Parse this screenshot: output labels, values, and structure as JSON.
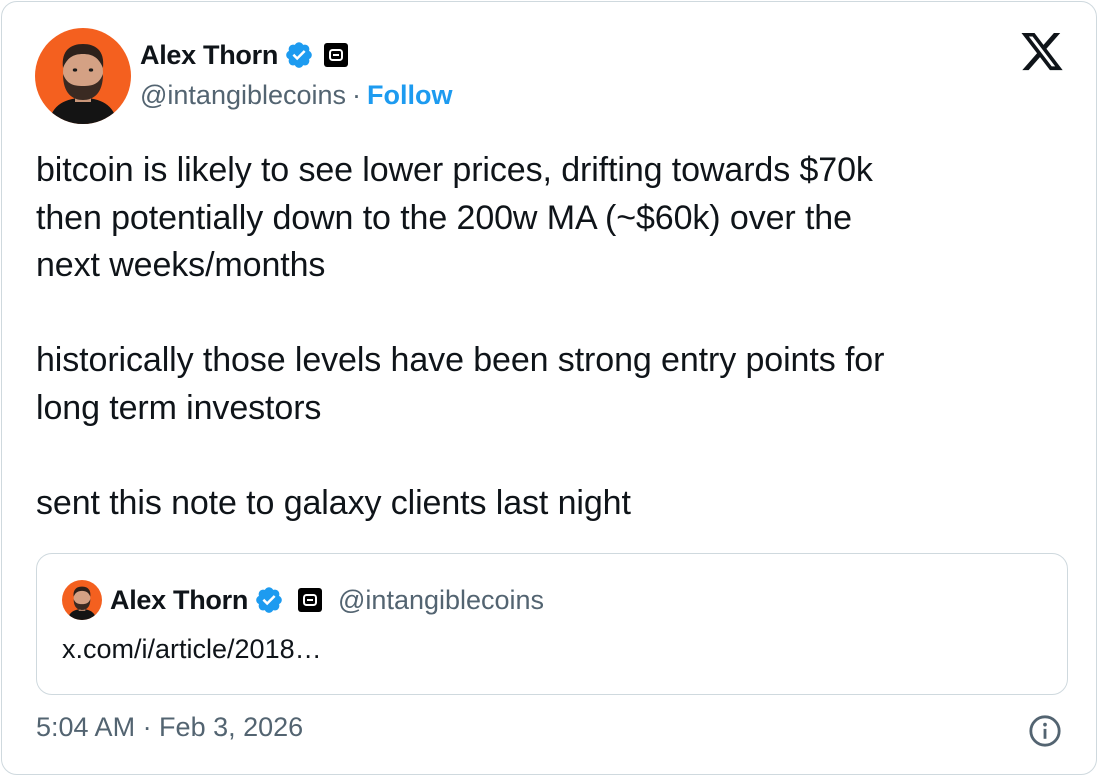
{
  "author": {
    "name": "Alex Thorn",
    "handle": "@intangiblecoins",
    "separator": "·",
    "follow_label": "Follow"
  },
  "tweet": {
    "text": "bitcoin is likely to see lower prices, drifting towards $70k\nthen potentially down to the 200w MA (~$60k) over the\nnext weeks/months\n\nhistorically those levels have been strong entry points for\nlong term investors\n\nsent this note to galaxy clients last night"
  },
  "quoted": {
    "name": "Alex Thorn",
    "handle": "@intangiblecoins",
    "link_text": "x.com/i/article/2018…"
  },
  "footer": {
    "timestamp": "5:04 AM · Feb 3, 2026"
  },
  "icons": {
    "verified": "verified-badge-icon",
    "affiliate": "affiliate-badge-icon",
    "platform": "x-logo-icon",
    "info": "info-icon"
  },
  "colors": {
    "accent": "#1d9bf0",
    "avatar_bg": "#f4601f",
    "text": "#0f1419",
    "secondary_text": "#536471",
    "border": "#cfd9de"
  }
}
